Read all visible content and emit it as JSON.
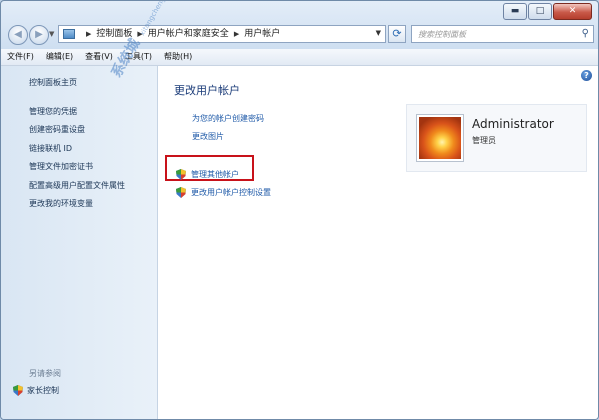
{
  "window": {
    "caption": {
      "minimize": "▬",
      "maximize": "□",
      "close": "✕"
    }
  },
  "navigation": {
    "back_icon": "back-arrow-icon",
    "forward_icon": "forward-arrow-icon",
    "breadcrumbs": [
      "控制面板",
      "用户帐户和家庭安全",
      "用户帐户"
    ],
    "search_placeholder": "搜索控制面板"
  },
  "menu": [
    "文件(F)",
    "编辑(E)",
    "查看(V)",
    "工具(T)",
    "帮助(H)"
  ],
  "sidebar": {
    "home": "控制面板主页",
    "links": [
      "管理您的凭据",
      "创建密码重设盘",
      "链接联机 ID",
      "管理文件加密证书",
      "配置高级用户配置文件属性",
      "更改我的环境变量"
    ],
    "see_also": "另请参阅",
    "parental_controls": "家长控制"
  },
  "main": {
    "title": "更改用户帐户",
    "tasks": [
      "为您的帐户创建密码",
      "更改图片",
      "管理其他帐户",
      "更改用户帐户控制设置"
    ],
    "account": {
      "name": "Administrator",
      "role": "管理员"
    }
  },
  "watermark": {
    "main": "系统城",
    "sub": "xitongcheng.com"
  },
  "colors": {
    "link": "#1f5aa8",
    "title": "#1a3b78",
    "highlight_box": "#c8121a"
  }
}
